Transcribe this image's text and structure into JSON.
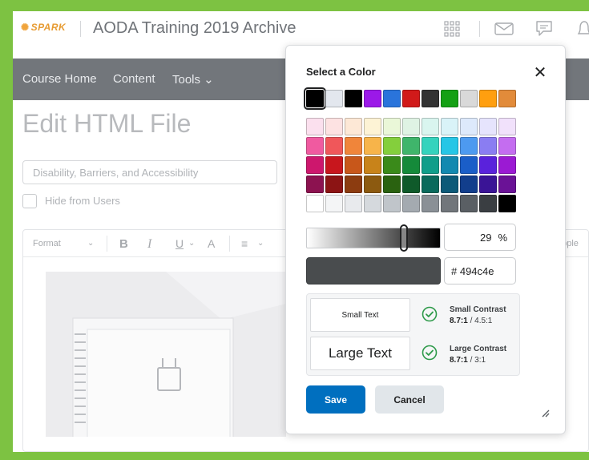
{
  "header": {
    "logo_text": "SPARK",
    "course_title": "AODA Training 2019 Archive",
    "icons": [
      "grid-icon",
      "mail-icon",
      "chat-icon",
      "bell-icon"
    ]
  },
  "nav": {
    "items": [
      "Course Home",
      "Content",
      "Tools ⌄"
    ]
  },
  "page": {
    "title": "Edit HTML File",
    "title_input_value": "Disability, Barriers, and Accessibility",
    "hide_label": "Hide from Users"
  },
  "editor": {
    "format_label": "Format",
    "bold": "B",
    "italic": "I",
    "underline": "U",
    "font_color": "A",
    "align": "≡",
    "applet_label": "apple"
  },
  "dialog": {
    "title": "Select a Color",
    "close_glyph": "✕",
    "basic_colors": [
      "#000000",
      "#e3e7ee",
      "#000000",
      "#9b19e8",
      "#2a74db",
      "#d11a1a",
      "#333333",
      "#14a014",
      "#d9d9d9",
      "#ff9f0f",
      "#e28b3a"
    ],
    "basic_selected_index": 0,
    "palette_rows": [
      [
        "#fbe0ee",
        "#fde2e2",
        "#fde8d6",
        "#fdf3d5",
        "#eaf7d8",
        "#dff3e4",
        "#d9f5ef",
        "#d9f3f8",
        "#dde9fb",
        "#e6e4fd",
        "#f1e1fb"
      ],
      [
        "#f05aa0",
        "#f0575a",
        "#f0853a",
        "#f7b44a",
        "#84cf3c",
        "#3fb56b",
        "#35d3bd",
        "#26c6e6",
        "#4d9af0",
        "#8a7df2",
        "#c46df0"
      ],
      [
        "#cd176d",
        "#c8161d",
        "#c8571a",
        "#c8831a",
        "#3a8a1a",
        "#158a3a",
        "#0f9e8a",
        "#1289b0",
        "#1a5ec8",
        "#5a22dc",
        "#9b1ad3"
      ],
      [
        "#8c1250",
        "#8c1414",
        "#8c3c10",
        "#8c5a10",
        "#2a6210",
        "#0f5a2a",
        "#0a6a5c",
        "#0c5a78",
        "#123e8c",
        "#3a1496",
        "#6a1296"
      ],
      [
        "#ffffff",
        "#f4f5f6",
        "#e8eaed",
        "#d5d9dd",
        "#c0c5ca",
        "#a4aab0",
        "#8a9096",
        "#71767b",
        "#5a5f64",
        "#3a3e42",
        "#000000"
      ]
    ],
    "lightness_percent": 29,
    "percent_sign": "%",
    "hex_value": "# 494c4e",
    "preview_color": "#494c4e",
    "small_sample": "Small Text",
    "large_sample": "Large Text",
    "small_contrast_label": "Small Contrast",
    "small_contrast_value": "8.7:1",
    "small_contrast_req": " / 4.5:1",
    "large_contrast_label": "Large Contrast",
    "large_contrast_value": "8.7:1",
    "large_contrast_req": " / 3:1",
    "save_label": "Save",
    "cancel_label": "Cancel",
    "check_color": "#2e9a4a"
  }
}
